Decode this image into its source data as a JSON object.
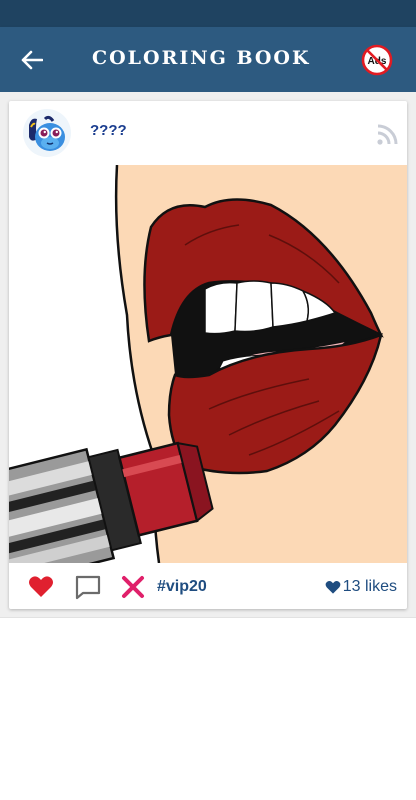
{
  "app_bar": {
    "title": "COLORING BOOK",
    "back_icon": "arrow-left-icon",
    "no_ads_label": "Ads",
    "no_ads_icon": "no-ads-icon"
  },
  "post": {
    "author_name": "????",
    "avatar_icon": "fish-avatar-icon",
    "feed_icon": "rss-icon",
    "artwork_subject": "lips-with-lipstick",
    "hashtag": "#vip20",
    "likes_text": "13 likes",
    "liked": true
  },
  "colors": {
    "status_bar": "#1f4361",
    "app_bar": "#2d5a80",
    "heart": "#e0202f",
    "remove": "#e0206a",
    "link": "#1f4d80",
    "lips": "#9b1b17",
    "skin": "#fcd9b6"
  }
}
